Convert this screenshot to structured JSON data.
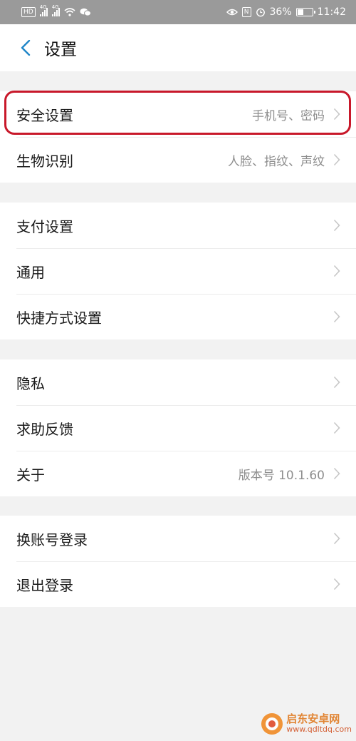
{
  "statusbar": {
    "hd_badge": "HD",
    "net1": "4G",
    "net2": "4G",
    "battery_percent": "36%",
    "nfc": "N",
    "time": "11:42"
  },
  "header": {
    "title": "设置"
  },
  "groups": [
    {
      "items": [
        {
          "label": "安全设置",
          "value": "手机号、密码"
        },
        {
          "label": "生物识别",
          "value": "人脸、指纹、声纹"
        }
      ]
    },
    {
      "items": [
        {
          "label": "支付设置",
          "value": ""
        },
        {
          "label": "通用",
          "value": ""
        },
        {
          "label": "快捷方式设置",
          "value": ""
        }
      ]
    },
    {
      "items": [
        {
          "label": "隐私",
          "value": ""
        },
        {
          "label": "求助反馈",
          "value": ""
        },
        {
          "label": "关于",
          "value": "版本号 10.1.60"
        }
      ]
    },
    {
      "items": [
        {
          "label": "换账号登录",
          "value": ""
        },
        {
          "label": "退出登录",
          "value": ""
        }
      ]
    }
  ],
  "highlight": {
    "target": "安全设置",
    "color": "#c8182a"
  },
  "watermark": {
    "name": "启东安卓网",
    "url": "www.qdltdq.com"
  },
  "colors": {
    "accent": "#1f86c8",
    "chevron": "#c7c7c7",
    "background": "#f2f2f2",
    "statusbar": "#9a9a9a"
  }
}
